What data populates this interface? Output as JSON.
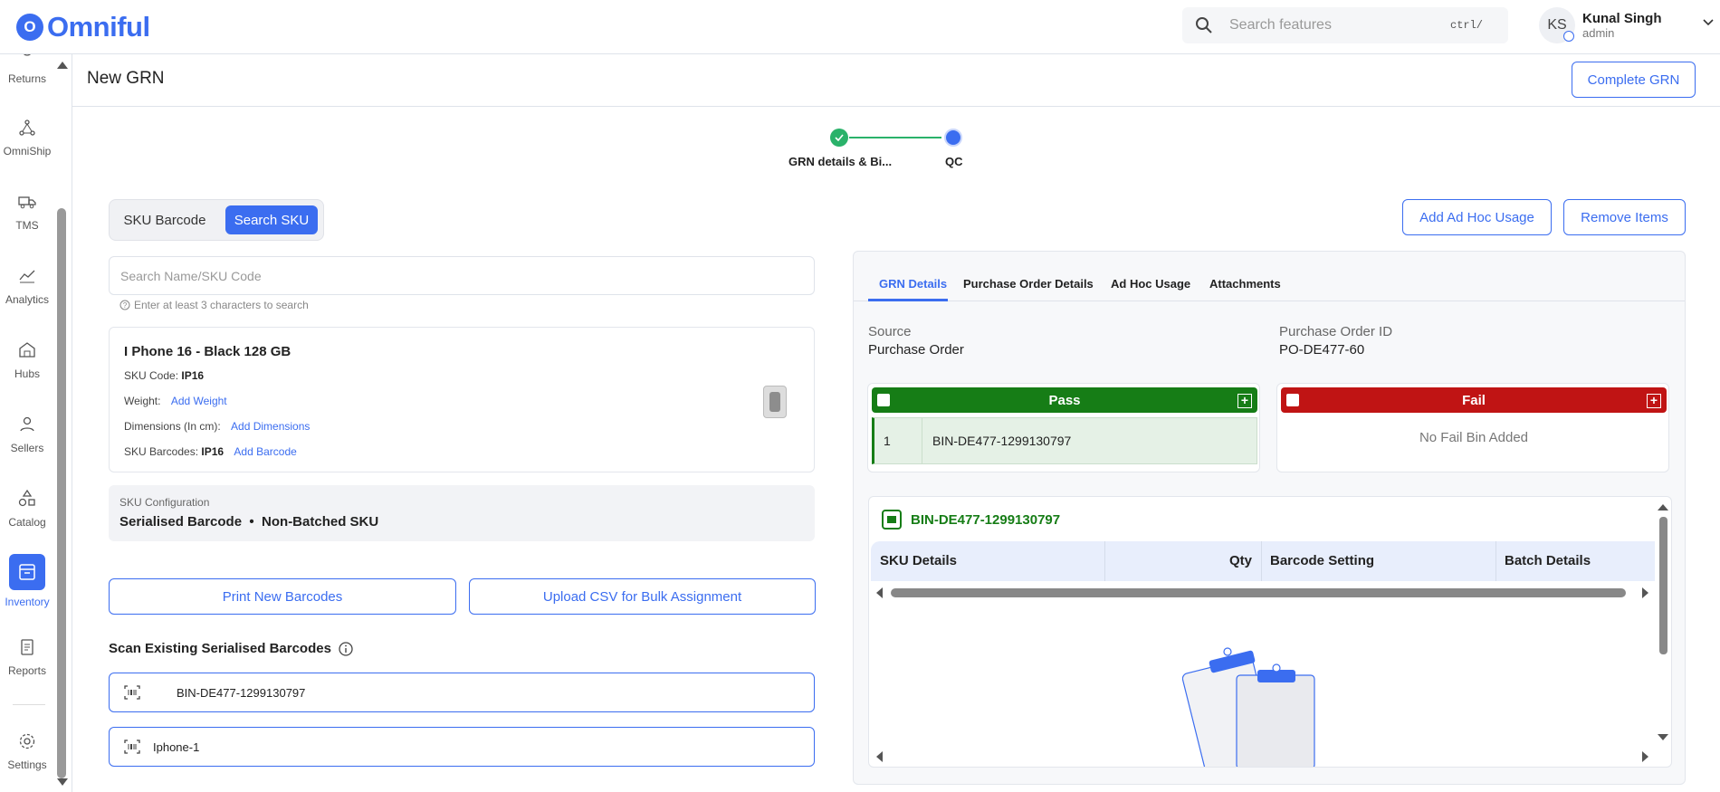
{
  "brand": {
    "name": "Omniful",
    "mark": "O"
  },
  "search": {
    "placeholder": "Search features",
    "shortcut": "ctrl/"
  },
  "user": {
    "initials": "KS",
    "name": "Kunal Singh",
    "role": "admin"
  },
  "sidebar": {
    "items": [
      {
        "label": "Returns",
        "icon": "returns-icon"
      },
      {
        "label": "OmniShip",
        "icon": "omniship-icon"
      },
      {
        "label": "TMS",
        "icon": "truck-icon"
      },
      {
        "label": "Analytics",
        "icon": "analytics-icon"
      },
      {
        "label": "Hubs",
        "icon": "hub-icon"
      },
      {
        "label": "Sellers",
        "icon": "user-icon"
      },
      {
        "label": "Catalog",
        "icon": "shapes-icon"
      },
      {
        "label": "Inventory",
        "icon": "inventory-icon"
      },
      {
        "label": "Reports",
        "icon": "report-icon"
      },
      {
        "label": "Settings",
        "icon": "gear-icon"
      }
    ],
    "active": "Inventory"
  },
  "page": {
    "title": "New GRN",
    "complete_label": "Complete GRN"
  },
  "stepper": {
    "steps": [
      "GRN details & Bi...",
      "QC"
    ],
    "current": 2
  },
  "left": {
    "toggle": {
      "option_a": "SKU Barcode",
      "option_b": "Search SKU",
      "selected": "Search SKU"
    },
    "search_placeholder": "Search Name/SKU Code",
    "hint": "Enter at least 3 characters to search",
    "sku": {
      "name": "I Phone 16 - Black 128 GB",
      "code_label": "SKU Code:",
      "code": "IP16",
      "weight_label": "Weight:",
      "weight_link": "Add Weight",
      "dimensions_label": "Dimensions (In cm):",
      "dimensions_link": "Add Dimensions",
      "barcodes_label": "SKU Barcodes:",
      "barcodes": "IP16",
      "barcode_link": "Add Barcode"
    },
    "config": {
      "label": "SKU Configuration",
      "value_a": "Serialised Barcode",
      "separator": "•",
      "value_b": "Non-Batched SKU"
    },
    "print_label": "Print New Barcodes",
    "upload_label": "Upload CSV for Bulk Assignment",
    "scan_title": "Scan Existing Serialised Barcodes",
    "scan_rows": [
      "BIN-DE477-1299130797",
      "Iphone-1"
    ]
  },
  "right": {
    "adhoc_label": "Add Ad Hoc Usage",
    "remove_label": "Remove Items",
    "tabs": [
      "GRN Details",
      "Purchase Order Details",
      "Ad Hoc Usage",
      "Attachments"
    ],
    "active_tab": "GRN Details",
    "source_label": "Source",
    "source": "Purchase Order",
    "po_label": "Purchase Order ID",
    "po": "PO-DE477-60",
    "pass": {
      "title": "Pass",
      "color": "#167d16",
      "row_no": "1",
      "bin": "BIN-DE477-1299130797"
    },
    "fail": {
      "title": "Fail",
      "color": "#c01414",
      "empty": "No Fail Bin Added"
    },
    "detail": {
      "bin": "BIN-DE477-1299130797",
      "columns": [
        "SKU Details",
        "Qty",
        "Barcode Setting",
        "Batch Details"
      ]
    }
  },
  "colors": {
    "primary": "#3b6df0",
    "success": "#2ab26a",
    "pass": "#167d16",
    "fail": "#c01414"
  }
}
